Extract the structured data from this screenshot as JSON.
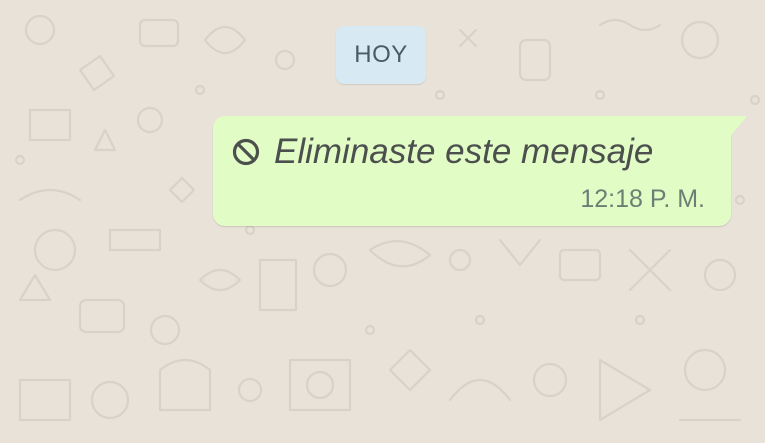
{
  "chat": {
    "date_separator": "HOY",
    "messages": [
      {
        "direction": "outgoing",
        "status": "deleted",
        "icon": "ban-icon",
        "text": "Eliminaste este mensaje",
        "time": "12:18 P. M."
      }
    ]
  },
  "colors": {
    "wallpaper": "#e8e2d8",
    "date_chip": "#d7e9f2",
    "outgoing_bubble": "#e2fcc6"
  }
}
